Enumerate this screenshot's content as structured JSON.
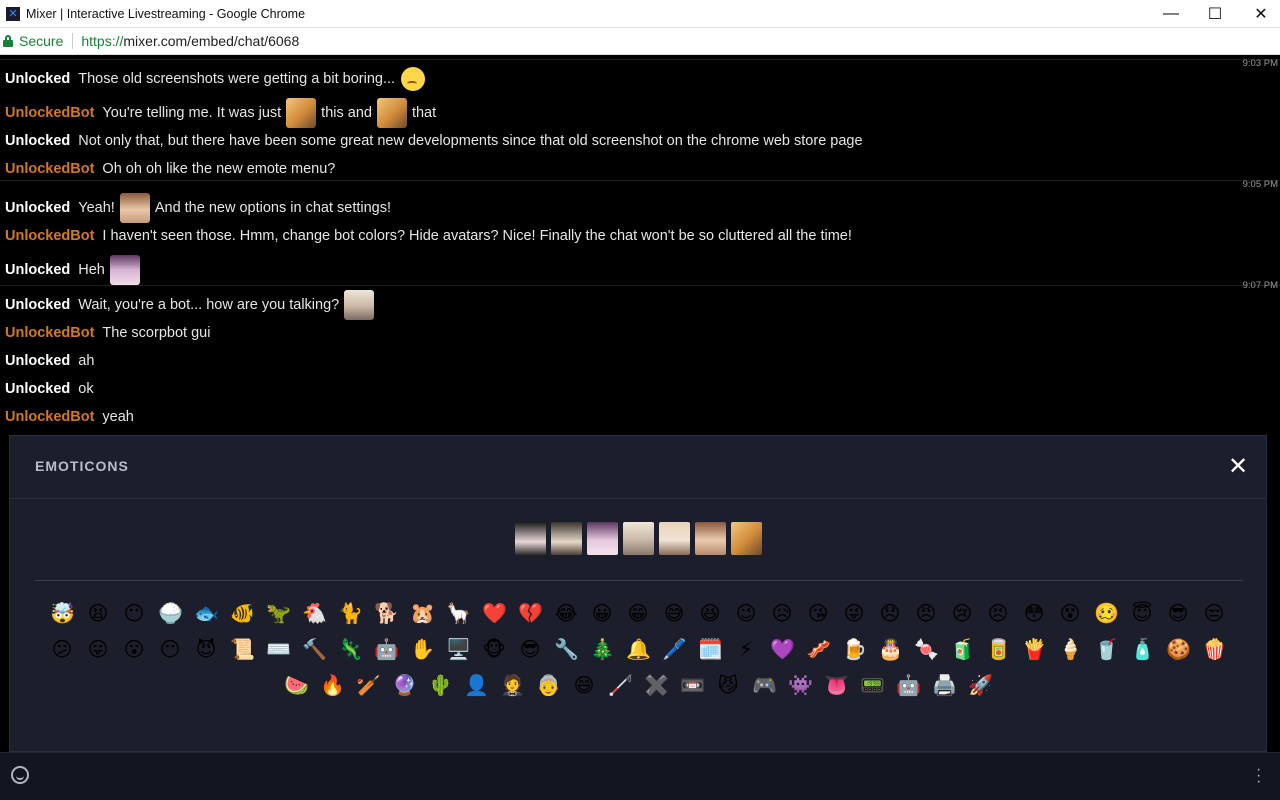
{
  "window": {
    "title": "Mixer | Interactive Livestreaming - Google Chrome",
    "minimize_glyph": "—",
    "maximize_glyph": "☐",
    "close_glyph": "✕"
  },
  "address": {
    "secure_label": "Secure",
    "url_scheme": "https://",
    "url_rest": "mixer.com/embed/chat/6068"
  },
  "chat": {
    "timestamps": [
      "9:03 PM",
      "9:05 PM",
      "9:07 PM"
    ],
    "messages": [
      {
        "user": "Unlocked",
        "text": "Those old screenshots were getting a bit boring..."
      },
      {
        "user": "UnlockedBot",
        "text_a": "You're telling me. It was just",
        "text_b": "this and",
        "text_c": "that"
      },
      {
        "user": "Unlocked",
        "text": "Not only that, but there have been some great new developments since that old screenshot on the chrome web store page"
      },
      {
        "user": "UnlockedBot",
        "text": "Oh oh oh like the new emote menu?"
      },
      {
        "user": "Unlocked",
        "text_a": "Yeah!",
        "text_b": "And the new options in chat settings!"
      },
      {
        "user": "UnlockedBot",
        "text": "I haven't seen those. Hmm, change bot colors? Hide avatars? Nice! Finally the chat won't be so cluttered all the time!"
      },
      {
        "user": "Unlocked",
        "text": "Heh"
      },
      {
        "user": "Unlocked",
        "text": "Wait, you're a bot... how are you talking?"
      },
      {
        "user": "UnlockedBot",
        "text": "The scorpbot gui"
      },
      {
        "user": "Unlocked",
        "text": "ah"
      },
      {
        "user": "Unlocked",
        "text": "ok"
      },
      {
        "user": "UnlockedBot",
        "text": "yeah"
      }
    ]
  },
  "emote_panel": {
    "title": "EMOTICONS",
    "close_glyph": "✕",
    "row1": [
      "🤯",
      "😫",
      "😶",
      "🍚",
      "🐟",
      "🐠",
      "🦖",
      "🐔",
      "🐈",
      "🐕",
      "🐹",
      "🦙",
      "❤️",
      "💔",
      "😂",
      "😀",
      "😁",
      "😅",
      "😆",
      "😉",
      "😥",
      "😘",
      "😜",
      "😞",
      "😠",
      "😢",
      "😣",
      "😳",
      "😵",
      "🥴",
      "😇",
      "😎",
      "😒"
    ],
    "row2": [
      "😕",
      "😛",
      "😮",
      "😶",
      "😈",
      "📜",
      "⌨️",
      "🔨",
      "🦎",
      "🤖",
      "✋",
      "🖥️",
      "🐵",
      "😎",
      "🔧",
      "🎄",
      "🔔",
      "🖊️",
      "🗓️",
      "⚡",
      "💜",
      "🥓",
      "🍺",
      "🎂",
      "🍬",
      "🧃",
      "🥫",
      "🍟",
      "🍦",
      "🥤",
      "🧴",
      "🍪",
      "🍿"
    ],
    "row3": [
      "🍉",
      "🔥",
      "🏏",
      "🔮",
      "🌵",
      "👤",
      "🤵",
      "👵",
      "😄",
      "🦯",
      "✖️",
      "📼",
      "😼",
      "🎮",
      "👾",
      "👅",
      "📟",
      "🤖",
      "🖨️",
      "🚀"
    ]
  }
}
